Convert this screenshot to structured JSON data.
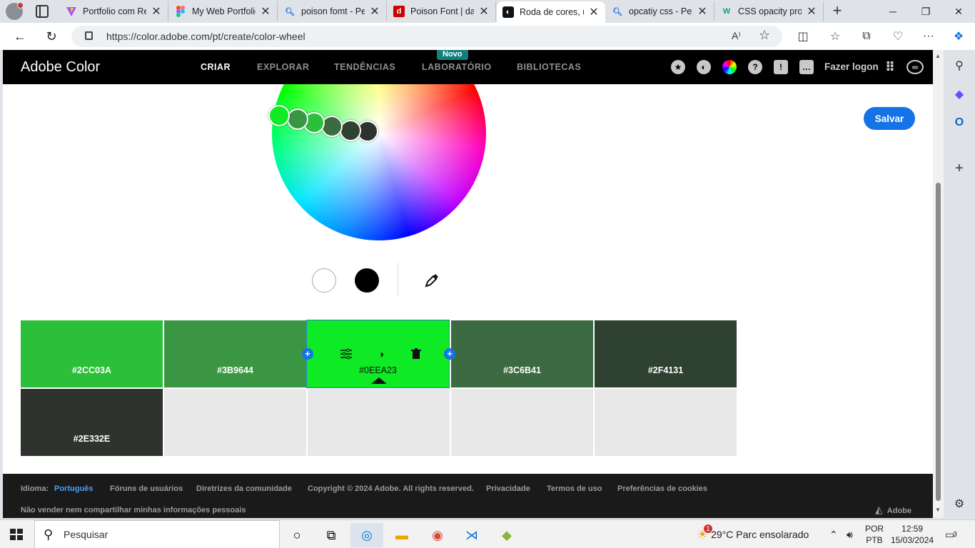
{
  "browser": {
    "tabs": [
      {
        "title": "Portfolio com Re",
        "icon": "vite-icon",
        "active": false
      },
      {
        "title": "My Web Portfolio",
        "icon": "figma-icon",
        "active": false
      },
      {
        "title": "poison fomt - Pe",
        "icon": "bing-search-icon",
        "active": false
      },
      {
        "title": "Poison Font | daf",
        "icon": "dafont-icon",
        "active": false
      },
      {
        "title": "Roda de cores, u",
        "icon": "adobe-color-icon",
        "active": true
      },
      {
        "title": "opcatiy css - Pes",
        "icon": "bing-search-icon",
        "active": false
      },
      {
        "title": "CSS opacity prop",
        "icon": "w3schools-icon",
        "active": false
      }
    ],
    "url": "https://color.adobe.com/pt/create/color-wheel",
    "read_aloud": "A⁾"
  },
  "header": {
    "logo": "Adobe Color",
    "nav": [
      "CRIAR",
      "EXPLORAR",
      "TENDÊNCIAS",
      "LABORATÓRIO",
      "BIBLIOTECAS"
    ],
    "badge": "Novo",
    "login": "Fazer logon"
  },
  "save_label": "Salvar",
  "colors": {
    "swatches": [
      "#2CC03A",
      "#3B9644",
      "#0EEA23",
      "#3C6B41",
      "#2F4131",
      "#2E332E"
    ],
    "wheel_handles": [
      "#2CC03A",
      "#3B9644",
      "#0EEA23",
      "#3C6B41",
      "#2F4131",
      "#2E332E"
    ],
    "selected_index": 2
  },
  "footer": {
    "lang_label": "Idioma:",
    "lang_value": "Português",
    "links": [
      "Fóruns de usuários",
      "Diretrizes da comunidade",
      "Copyright © 2024 Adobe. All rights reserved.",
      "Privacidade",
      "Termos de uso",
      "Preferências de cookies"
    ],
    "do_not_sell": "Não vender nem compartilhar minhas informações pessoais",
    "brand": "Adobe"
  },
  "taskbar": {
    "search_placeholder": "Pesquisar",
    "weather": "29°C  Parc ensolarado",
    "weather_badge": "1",
    "lang": "POR",
    "layout": "PTB",
    "time": "12:59",
    "date": "15/03/2024",
    "notifications": "3"
  }
}
